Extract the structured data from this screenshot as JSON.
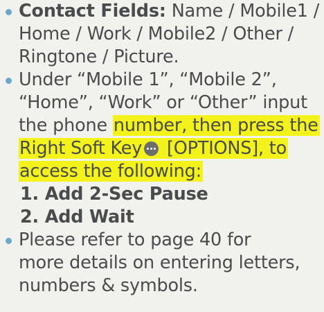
{
  "bullets": [
    {
      "lead": "Contact Fields:",
      "lines": [
        " Name / Mobile1 /",
        "Home / Work / Mobile2 / Other /",
        "Ringtone / Picture."
      ]
    },
    {
      "lines": [
        "Under “Mobile 1”, “Mobile 2”,",
        "“Home”, “Work” or “Other” input",
        "the phone "
      ],
      "highlight": {
        "l3": "number, then press the",
        "l4a": "Right Soft Key",
        "l4b": " [OPTIONS], to",
        "l5": "access the following:"
      },
      "key_icon": "ellipsis-softkey-icon",
      "options": [
        "1. Add 2-Sec Pause",
        "2. Add Wait"
      ]
    },
    {
      "lines": [
        "Please refer to page 40 for",
        "more details on entering letters,",
        "numbers & symbols."
      ]
    }
  ],
  "colors": {
    "background": "#f1f2ed",
    "text": "#4a4b4d",
    "bullet": "#6aa7c8",
    "highlight": "#f3f21a"
  }
}
